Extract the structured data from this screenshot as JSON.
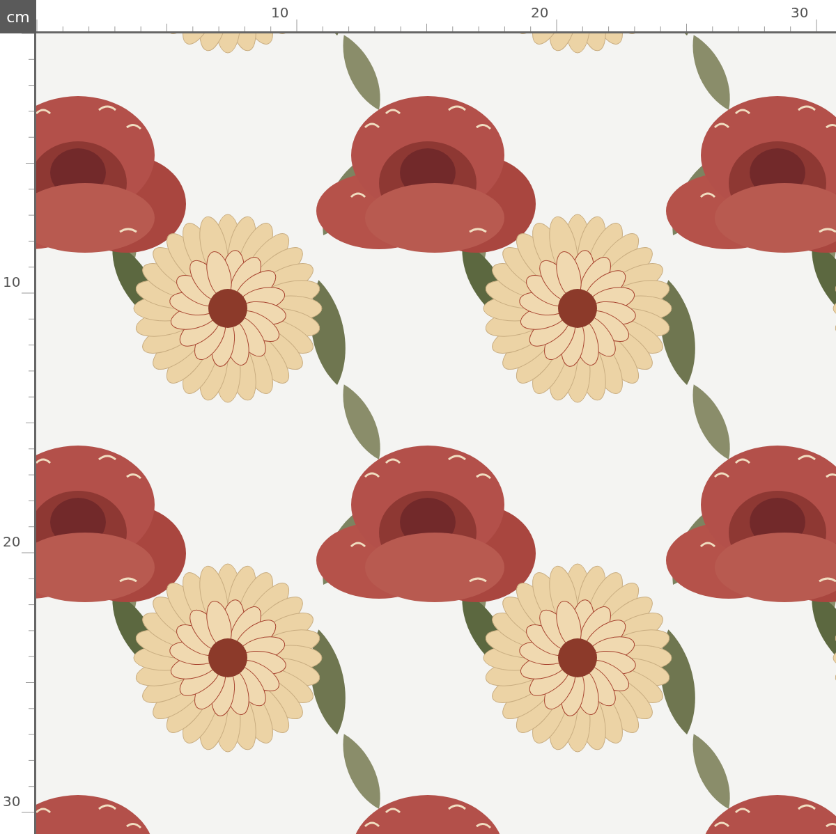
{
  "unit": "cm",
  "top_ruler": {
    "labels": [
      "10",
      "20",
      "30"
    ]
  },
  "left_ruler": {
    "labels": [
      "10",
      "20",
      "30"
    ]
  }
}
